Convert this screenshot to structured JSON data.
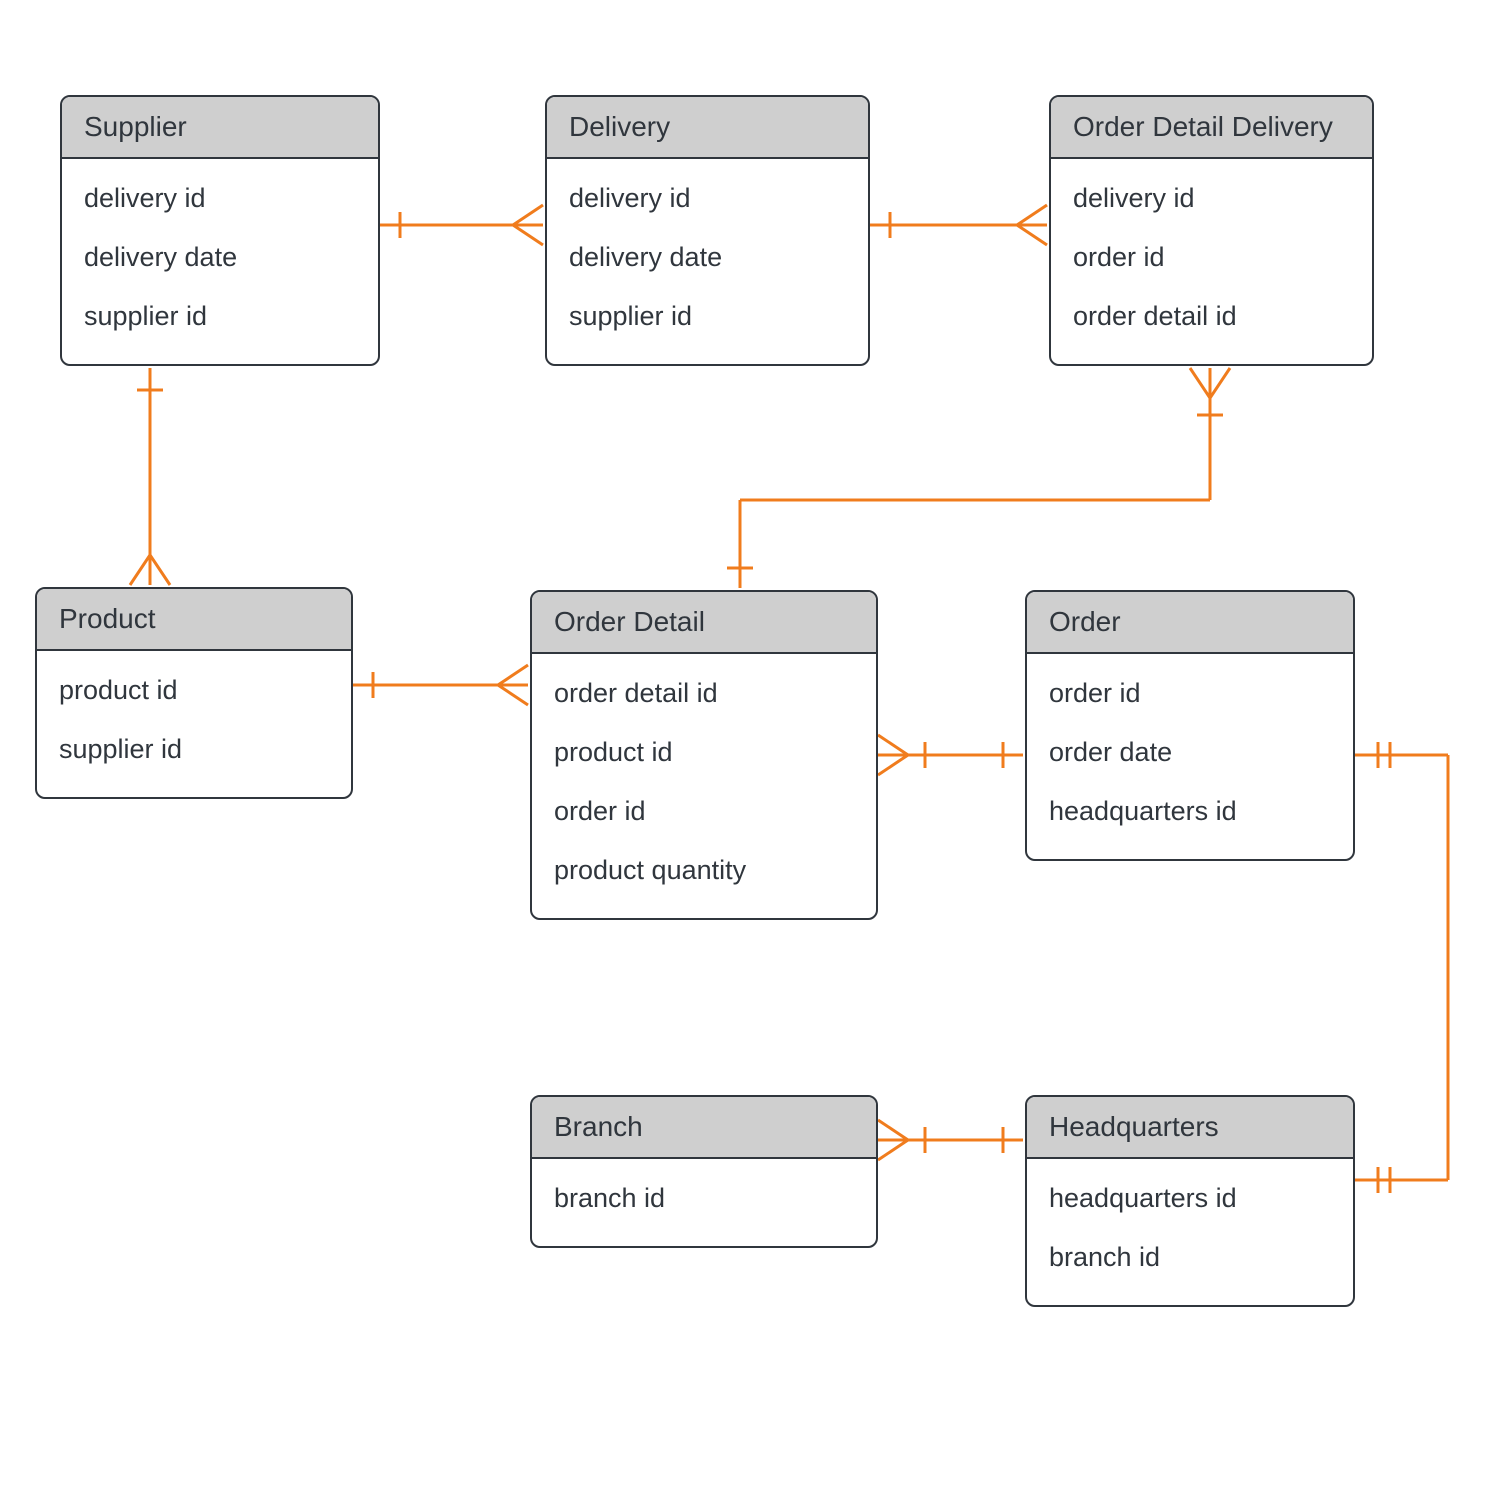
{
  "diagram": {
    "type": "entity-relationship",
    "entities": {
      "supplier": {
        "title": "Supplier",
        "attrs": [
          "delivery id",
          "delivery date",
          "supplier id"
        ]
      },
      "delivery": {
        "title": "Delivery",
        "attrs": [
          "delivery id",
          "delivery date",
          "supplier id"
        ]
      },
      "orderDetailDelivery": {
        "title": "Order Detail Delivery",
        "attrs": [
          "delivery id",
          "order id",
          "order detail id"
        ]
      },
      "product": {
        "title": "Product",
        "attrs": [
          "product id",
          "supplier id"
        ]
      },
      "orderDetail": {
        "title": "Order Detail",
        "attrs": [
          "order detail id",
          "product id",
          "order id",
          "product quantity"
        ]
      },
      "order": {
        "title": "Order",
        "attrs": [
          "order id",
          "order date",
          "headquarters id"
        ]
      },
      "branch": {
        "title": "Branch",
        "attrs": [
          "branch id"
        ]
      },
      "headquarters": {
        "title": "Headquarters",
        "attrs": [
          "headquarters id",
          "branch id"
        ]
      }
    },
    "relationships": [
      {
        "from": "supplier",
        "to": "delivery",
        "type": "one-to-many"
      },
      {
        "from": "delivery",
        "to": "orderDetailDelivery",
        "type": "one-to-many"
      },
      {
        "from": "supplier",
        "to": "product",
        "type": "one-to-many"
      },
      {
        "from": "product",
        "to": "orderDetail",
        "type": "one-to-many"
      },
      {
        "from": "orderDetail",
        "to": "orderDetailDelivery",
        "type": "many-to-one-bidir"
      },
      {
        "from": "order",
        "to": "orderDetail",
        "type": "one-to-many"
      },
      {
        "from": "order",
        "to": "headquarters",
        "type": "one-to-one"
      },
      {
        "from": "headquarters",
        "to": "branch",
        "type": "one-to-many"
      }
    ],
    "colors": {
      "connector": "#f07c1d",
      "entityBorder": "#30363d",
      "entityHeader": "#cfcfcf",
      "text": "#30363d"
    }
  }
}
